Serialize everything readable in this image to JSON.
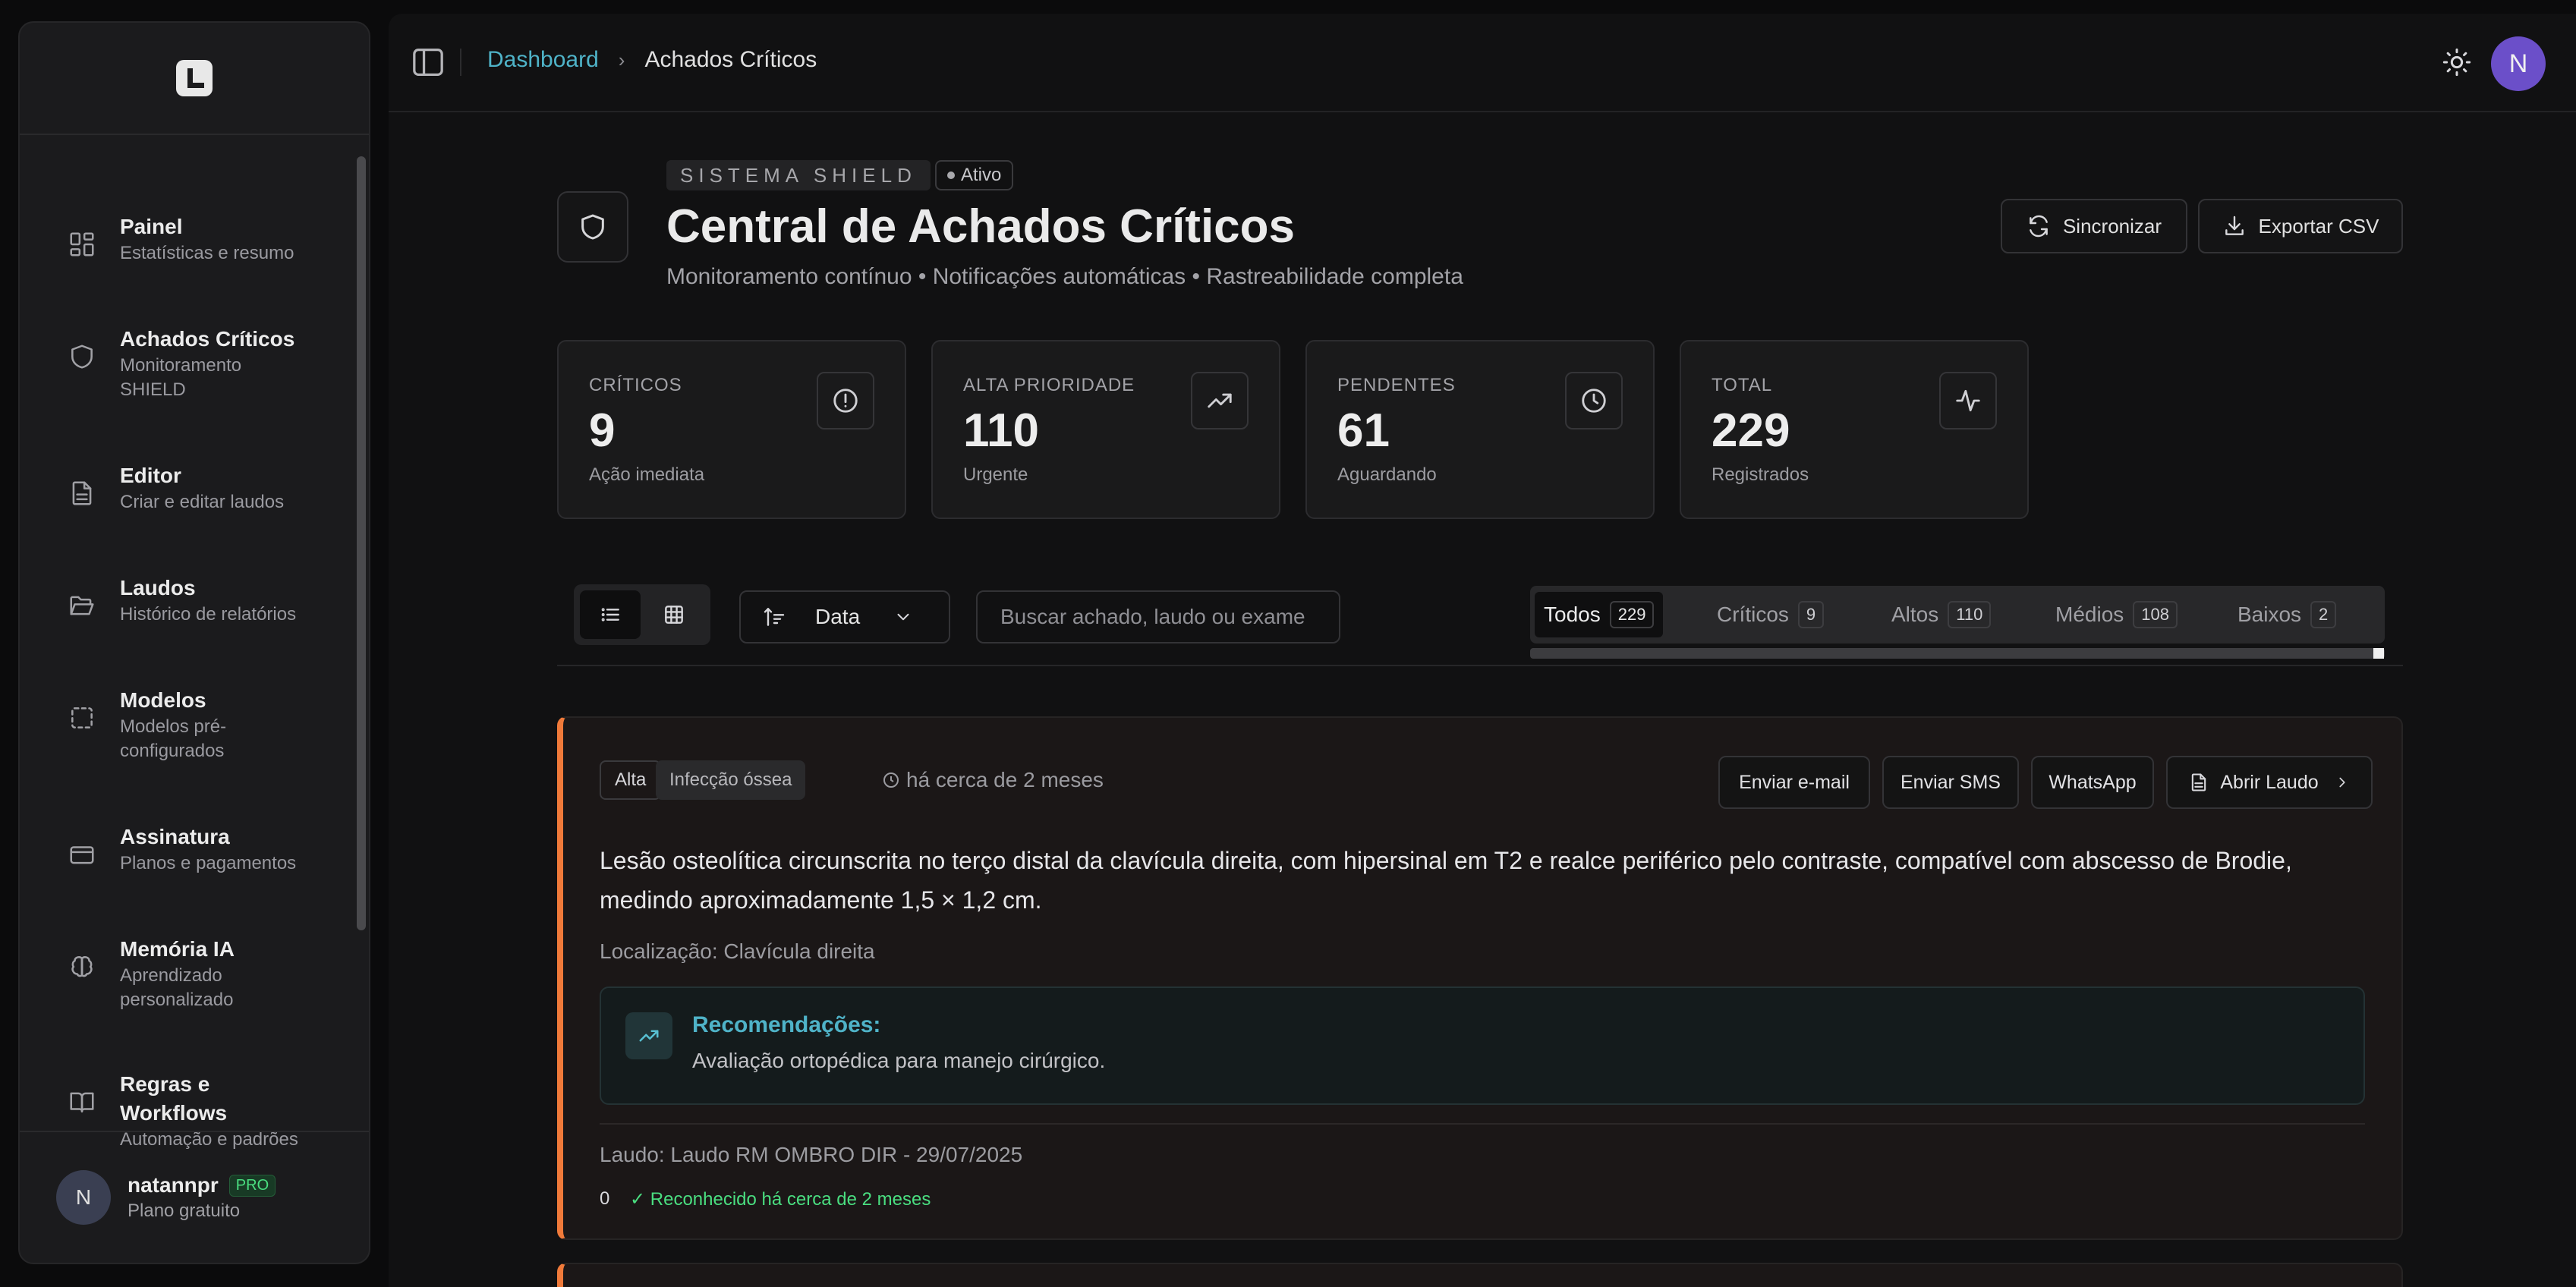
{
  "sidebar": {
    "items": [
      {
        "title": "Painel",
        "subtitle": "Estatísticas e resumo",
        "icon": "dashboard-grid-icon"
      },
      {
        "title": "Achados Críticos",
        "subtitle": "Monitoramento SHIELD",
        "icon": "shield-icon"
      },
      {
        "title": "Editor",
        "subtitle": "Criar e editar laudos",
        "icon": "file-text-icon"
      },
      {
        "title": "Laudos",
        "subtitle": "Histórico de relatórios",
        "icon": "folder-open-icon"
      },
      {
        "title": "Modelos",
        "subtitle": "Modelos pré-configurados",
        "icon": "dashed-square-icon"
      },
      {
        "title": "Assinatura",
        "subtitle": "Planos e pagamentos",
        "icon": "credit-card-icon"
      },
      {
        "title": "Memória IA",
        "subtitle": "Aprendizado personalizado",
        "icon": "brain-icon"
      },
      {
        "title": "Regras e Workflows",
        "subtitle": "Automação e padrões",
        "icon": "book-open-icon"
      }
    ],
    "user": {
      "initial": "N",
      "name": "natannpr",
      "badge": "PRO",
      "plan": "Plano gratuito"
    }
  },
  "topbar": {
    "breadcrumb": {
      "link": "Dashboard",
      "current": "Achados Críticos"
    },
    "avatar_initial": "N"
  },
  "header": {
    "system_label": "SISTEMA SHIELD",
    "status": "Ativo",
    "title": "Central de Achados Críticos",
    "subtitle": "Monitoramento contínuo • Notificações automáticas • Rastreabilidade completa",
    "sync_label": "Sincronizar",
    "export_label": "Exportar CSV"
  },
  "stats": [
    {
      "label": "CRÍTICOS",
      "value": "9",
      "caption": "Ação imediata",
      "icon": "alert-circle-icon"
    },
    {
      "label": "ALTA PRIORIDADE",
      "value": "110",
      "caption": "Urgente",
      "icon": "trending-up-icon"
    },
    {
      "label": "PENDENTES",
      "value": "61",
      "caption": "Aguardando",
      "icon": "clock-icon"
    },
    {
      "label": "TOTAL",
      "value": "229",
      "caption": "Registrados",
      "icon": "activity-icon"
    }
  ],
  "toolbar": {
    "sort_label": "Data",
    "search_placeholder": "Buscar achado, laudo ou exame",
    "tabs": [
      {
        "label": "Todos",
        "count": "229"
      },
      {
        "label": "Críticos",
        "count": "9"
      },
      {
        "label": "Altos",
        "count": "110"
      },
      {
        "label": "Médios",
        "count": "108"
      },
      {
        "label": "Baixos",
        "count": "2"
      }
    ]
  },
  "finding": {
    "severity": "Alta",
    "category": "Infecção óssea",
    "time": "há cerca de 2 meses",
    "actions": {
      "email": "Enviar e-mail",
      "sms": "Enviar SMS",
      "whatsapp": "WhatsApp",
      "open": "Abrir Laudo"
    },
    "description": "Lesão osteolítica circunscrita no terço distal da clavícula direita, com hipersinal em T2 e realce periférico pelo contraste, compatível com abscesso de Brodie, medindo aproximadamente 1,5 × 1,2 cm.",
    "location": "Localização: Clavícula direita",
    "recommendation_title": "Recomendações:",
    "recommendation_text": "Avaliação ortopédica para manejo cirúrgico.",
    "report": "Laudo: Laudo RM OMBRO DIR - 29/07/2025",
    "count": "0",
    "acknowledged": "✓ Reconhecido há cerca de 2 meses"
  },
  "colors": {
    "accent": "#4fb3c8",
    "severity_high": "#f07a3a",
    "success": "#4ade80",
    "avatar": "#6b4fc9"
  }
}
